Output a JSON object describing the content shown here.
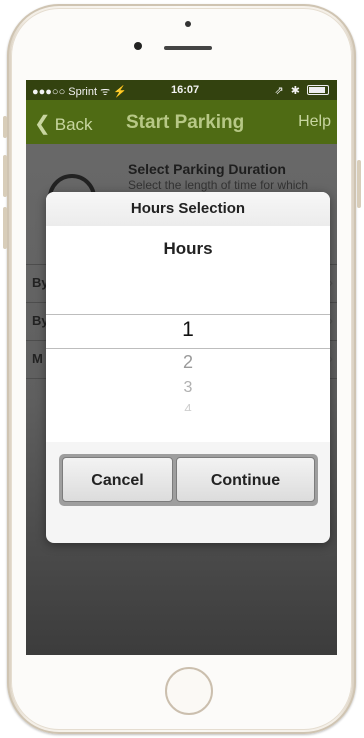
{
  "status_bar": {
    "carrier": "●●●○○ Sprint ᯤ ⚡",
    "time": "16:07",
    "right_icons": "⇗ ✱"
  },
  "nav": {
    "back_label": "Back",
    "title": "Start Parking",
    "help_label": "Help"
  },
  "background": {
    "section_title": "Select Parking Duration",
    "section_subtitle": "Select the length of time for which",
    "rows": [
      "By",
      "By",
      "M"
    ]
  },
  "dialog": {
    "title": "Hours Selection",
    "picker_label": "Hours",
    "options": [
      "1",
      "2",
      "3",
      "4"
    ],
    "selected": "1",
    "cancel_label": "Cancel",
    "continue_label": "Continue"
  },
  "colors": {
    "nav_green": "#4f6b14",
    "status_green": "#33420f",
    "nav_text": "#c8d6a0"
  },
  "icons": {
    "back": "chevron-left-icon",
    "battery": "battery-icon",
    "wifi": "wifi-icon",
    "bluetooth": "bluetooth-icon"
  }
}
